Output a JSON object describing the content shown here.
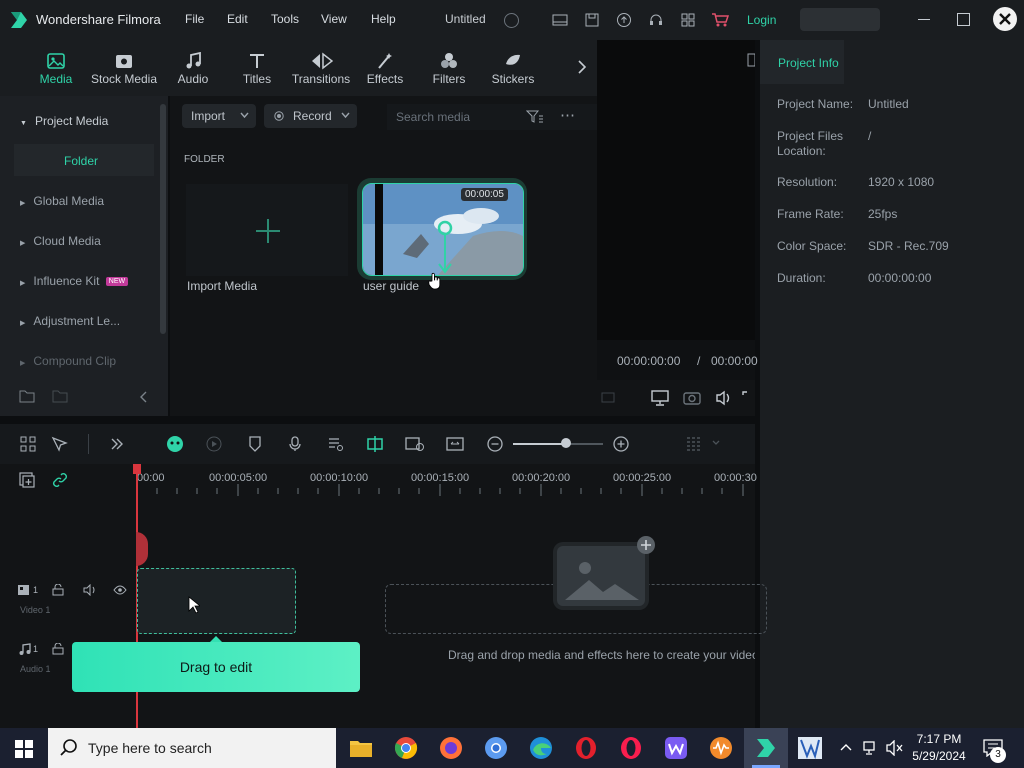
{
  "app": {
    "title": "Wondershare Filmora",
    "menus": [
      "File",
      "Edit",
      "Tools",
      "View",
      "Help"
    ],
    "project_title": "Untitled",
    "login_label": "Login"
  },
  "toolbar": {
    "items": [
      "Media",
      "Stock Media",
      "Audio",
      "Titles",
      "Transitions",
      "Effects",
      "Filters",
      "Stickers"
    ]
  },
  "sidebar": {
    "items": [
      "Project Media",
      "Folder",
      "Global Media",
      "Cloud Media",
      "Influence Kit",
      "Adjustment Le...",
      "Compound Clip"
    ],
    "new_badge": "NEW"
  },
  "media": {
    "import_label": "Import",
    "record_label": "Record",
    "search_placeholder": "Search media",
    "folder_heading": "FOLDER",
    "import_media_label": "Import Media",
    "clip_duration": "00:00:05",
    "clip_name": "user guide"
  },
  "preview": {
    "current_time": "00:00:00:00",
    "separator": "/",
    "total_time": "00:00:00"
  },
  "project_info": {
    "tab_label": "Project Info",
    "fields": [
      {
        "label": "Project Name:",
        "value": "Untitled"
      },
      {
        "label": "Project Files Location:",
        "value": "/"
      },
      {
        "label": "Resolution:",
        "value": "1920 x 1080"
      },
      {
        "label": "Frame Rate:",
        "value": "25fps"
      },
      {
        "label": "Color Space:",
        "value": "SDR - Rec.709"
      },
      {
        "label": "Duration:",
        "value": "00:00:00:00"
      }
    ]
  },
  "timeline": {
    "ruler": [
      "00:00",
      "00:00:05:00",
      "00:00:10:00",
      "00:00:15:00",
      "00:00:20:00",
      "00:00:25:00",
      "00:00:30"
    ],
    "video_track": "Video 1",
    "audio_track": "Audio 1",
    "drop_hint": "Drag and drop media and effects here to create your video.",
    "drag_tooltip": "Drag to edit"
  },
  "taskbar": {
    "search_placeholder": "Type here to search",
    "time": "7:17 PM",
    "date": "5/29/2024",
    "notification_count": "3"
  },
  "colors": {
    "accent": "#31d2a6",
    "tooltip_start": "#2fe2b6",
    "tooltip_end": "#5df0c5",
    "playhead": "#d9363e"
  }
}
